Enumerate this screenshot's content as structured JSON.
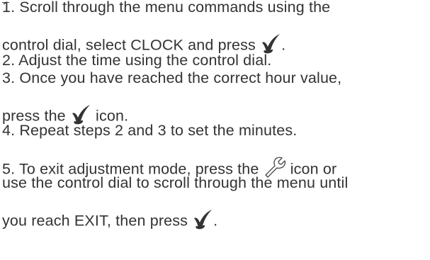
{
  "document": {
    "partial_line": "...",
    "step1_line1": "1. Scroll through the menu commands using the",
    "step1_line2_before": "control dial, select CLOCK and press ",
    "step1_line2_after": ".",
    "step2": "2. Adjust the time using the control dial.",
    "step3_line1": "3. Once you have reached the correct hour value,",
    "step3_line2_before": "press the ",
    "step3_line2_after": " icon.",
    "step4": "4. Repeat steps 2 and 3 to set the minutes.",
    "step5_line1_before": "5. To exit adjustment mode, press the ",
    "step5_line1_after": " icon or",
    "step5_line2": "use the control dial to scroll through the menu until",
    "step5_line3_before": "you reach EXIT, then press ",
    "step5_line3_after": "."
  },
  "icons": {
    "confirm": "check-icon",
    "settings": "wrench-icon"
  }
}
